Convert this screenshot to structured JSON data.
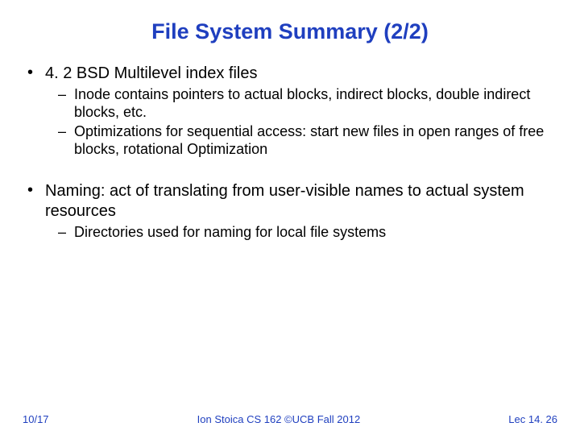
{
  "title": "File System Summary (2/2)",
  "bullets": [
    {
      "text": "4. 2 BSD Multilevel index files",
      "sub": [
        "Inode contains pointers to actual blocks, indirect blocks, double indirect blocks, etc.",
        "Optimizations for sequential access: start new files in open ranges of free blocks, rotational Optimization"
      ]
    },
    {
      "text": "Naming: act of translating from user-visible names to actual system resources",
      "sub": [
        "Directories used for naming for local file systems"
      ]
    }
  ],
  "footer": {
    "left": "10/17",
    "center": "Ion Stoica CS 162 ©UCB Fall 2012",
    "right": "Lec 14. 26"
  }
}
